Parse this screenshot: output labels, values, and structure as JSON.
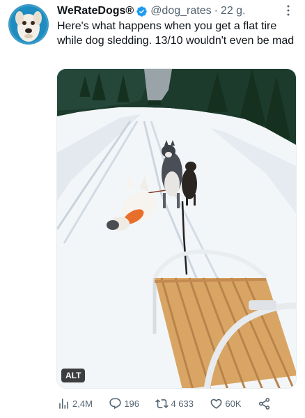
{
  "author": {
    "display_name": "WeRateDogs®",
    "handle": "@dog_rates",
    "separator": "·",
    "time": "22 g.",
    "verified": true
  },
  "tweet": {
    "text": "Here's what happens when you get a flat tire while dog sledding. 13/10 wouldn't even be mad"
  },
  "media": {
    "alt_label": "ALT"
  },
  "actions": {
    "views": "2,4M",
    "replies": "196",
    "retweets": "4 633",
    "likes": "60K"
  },
  "colors": {
    "text": "#0f1419",
    "secondary": "#536471",
    "verified": "#1d9bf0"
  },
  "icons": [
    "more-icon",
    "verified-badge-icon",
    "views-icon",
    "reply-icon",
    "retweet-icon",
    "like-icon",
    "share-icon"
  ]
}
